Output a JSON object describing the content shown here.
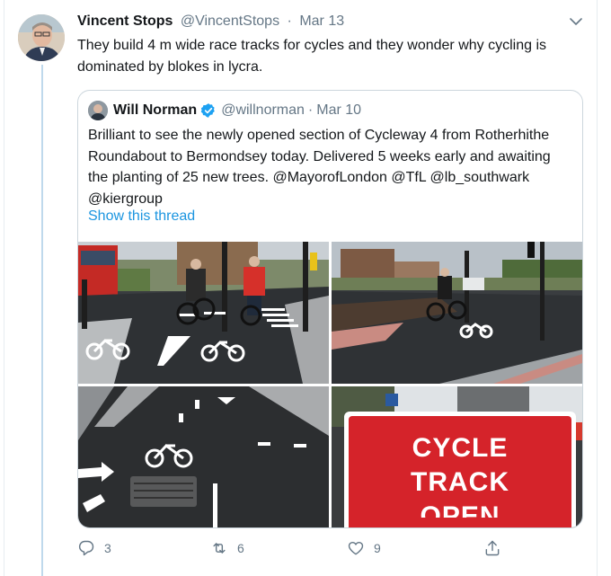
{
  "tweet": {
    "author_name": "Vincent Stops",
    "author_handle": "@VincentStops",
    "date": "Mar 13",
    "text": "They build 4 m wide race tracks for cycles and they wonder why cycling is dominated by blokes in lycra.",
    "separator": "·"
  },
  "quote": {
    "author_name": "Will Norman",
    "author_handle": "@willnorman",
    "date": "Mar 10",
    "text": "Brilliant to see the newly opened section of Cycleway 4 from Rotherhithe Roundabout to Bermondsey today. Delivered 5 weeks early and awaiting the planting of 25 new trees. @MayorofLondon @TfL @lb_southwark @kiergroup",
    "show_thread": "Show this thread",
    "sign_line1": "CYCLE",
    "sign_line2": "TRACK",
    "sign_line3": "OPEN"
  },
  "actions": {
    "reply_count": "3",
    "retweet_count": "6",
    "like_count": "9"
  },
  "icons": [
    "chevron-down-icon",
    "verified-badge-icon",
    "reply-icon",
    "retweet-icon",
    "like-icon",
    "share-icon"
  ],
  "colors": {
    "link": "#1b95e0",
    "verified": "#1da1f2",
    "secondary_text": "#657786",
    "thread_line": "#bfd9ec"
  }
}
